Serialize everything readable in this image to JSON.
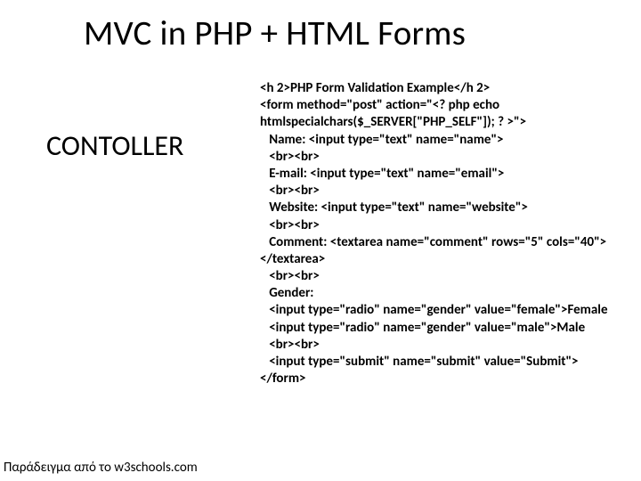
{
  "title": "MVC in PHP + HTML Forms",
  "label": "CONTOLLER",
  "code_lines": [
    "<h 2>PHP Form Validation Example</h 2>",
    "<form method=\"post\" action=\"<? php echo",
    "htmlspecialchars($_SERVER[\"PHP_SELF\"]); ? >\">",
    "   Name: <input type=\"text\" name=\"name\">",
    "   <br><br>",
    "   E-mail: <input type=\"text\" name=\"email\">",
    "   <br><br>",
    "   Website: <input type=\"text\" name=\"website\">",
    "   <br><br>",
    "   Comment: <textarea name=\"comment\" rows=\"5\" cols=\"40\"></textarea>",
    "   <br><br>",
    "   Gender:",
    "   <input type=\"radio\" name=\"gender\" value=\"female\">Female",
    "   <input type=\"radio\" name=\"gender\" value=\"male\">Male",
    "   <br><br>",
    "   <input type=\"submit\" name=\"submit\" value=\"Submit\">",
    "</form>"
  ],
  "caption": "Παράδειγμα από το w3schools.com"
}
